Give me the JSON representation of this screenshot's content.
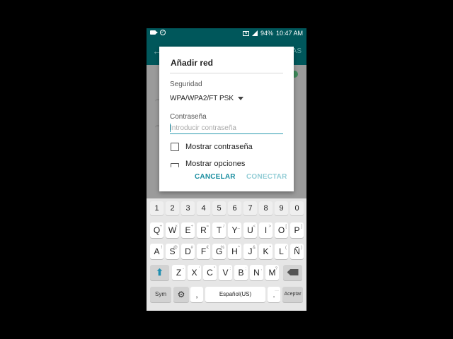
{
  "status_bar": {
    "battery": "94%",
    "time": "10:47 AM"
  },
  "background": {
    "header_more": "AS"
  },
  "dialog": {
    "title": "Añadir red",
    "security_label": "Seguridad",
    "security_value": "WPA/WPA2/FT PSK",
    "password_label": "Contraseña",
    "password_placeholder": "Introducir contraseña",
    "password_value": "",
    "show_password": "Mostrar contraseña",
    "show_options": "Mostrar opciones",
    "cancel": "CANCELAR",
    "connect": "CONECTAR"
  },
  "keyboard": {
    "numbers": [
      "1",
      "2",
      "3",
      "4",
      "5",
      "6",
      "7",
      "8",
      "9",
      "0"
    ],
    "row1": [
      {
        "k": "Q",
        "s": "+"
      },
      {
        "k": "W",
        "s": "×"
      },
      {
        "k": "E",
        "s": "÷"
      },
      {
        "k": "R",
        "s": "="
      },
      {
        "k": "T",
        "s": "/"
      },
      {
        "k": "Y",
        "s": "_"
      },
      {
        "k": "U",
        "s": "<"
      },
      {
        "k": "I",
        "s": ">"
      },
      {
        "k": "O",
        "s": "["
      },
      {
        "k": "P",
        "s": "]"
      }
    ],
    "row2": [
      {
        "k": "A",
        "s": "!"
      },
      {
        "k": "S",
        "s": "@"
      },
      {
        "k": "D",
        "s": "#"
      },
      {
        "k": "F",
        "s": "€"
      },
      {
        "k": "G",
        "s": "%"
      },
      {
        "k": "H",
        "s": "^"
      },
      {
        "k": "J",
        "s": "&"
      },
      {
        "k": "K",
        "s": "*"
      },
      {
        "k": "L",
        "s": "("
      },
      {
        "k": "Ñ",
        "s": ")"
      }
    ],
    "row3": [
      {
        "k": "Z",
        "s": "-"
      },
      {
        "k": "X",
        "s": "'"
      },
      {
        "k": "C",
        "s": "\""
      },
      {
        "k": "V",
        "s": ":"
      },
      {
        "k": "B",
        "s": ";"
      },
      {
        "k": "N",
        "s": ","
      },
      {
        "k": "M",
        "s": "?"
      }
    ],
    "sym": "Sym",
    "comma": ",",
    "space": "Español(US)",
    "period": ".",
    "period_sub": "···",
    "enter": "Aceptar",
    "shift_glyph": "⬆"
  }
}
